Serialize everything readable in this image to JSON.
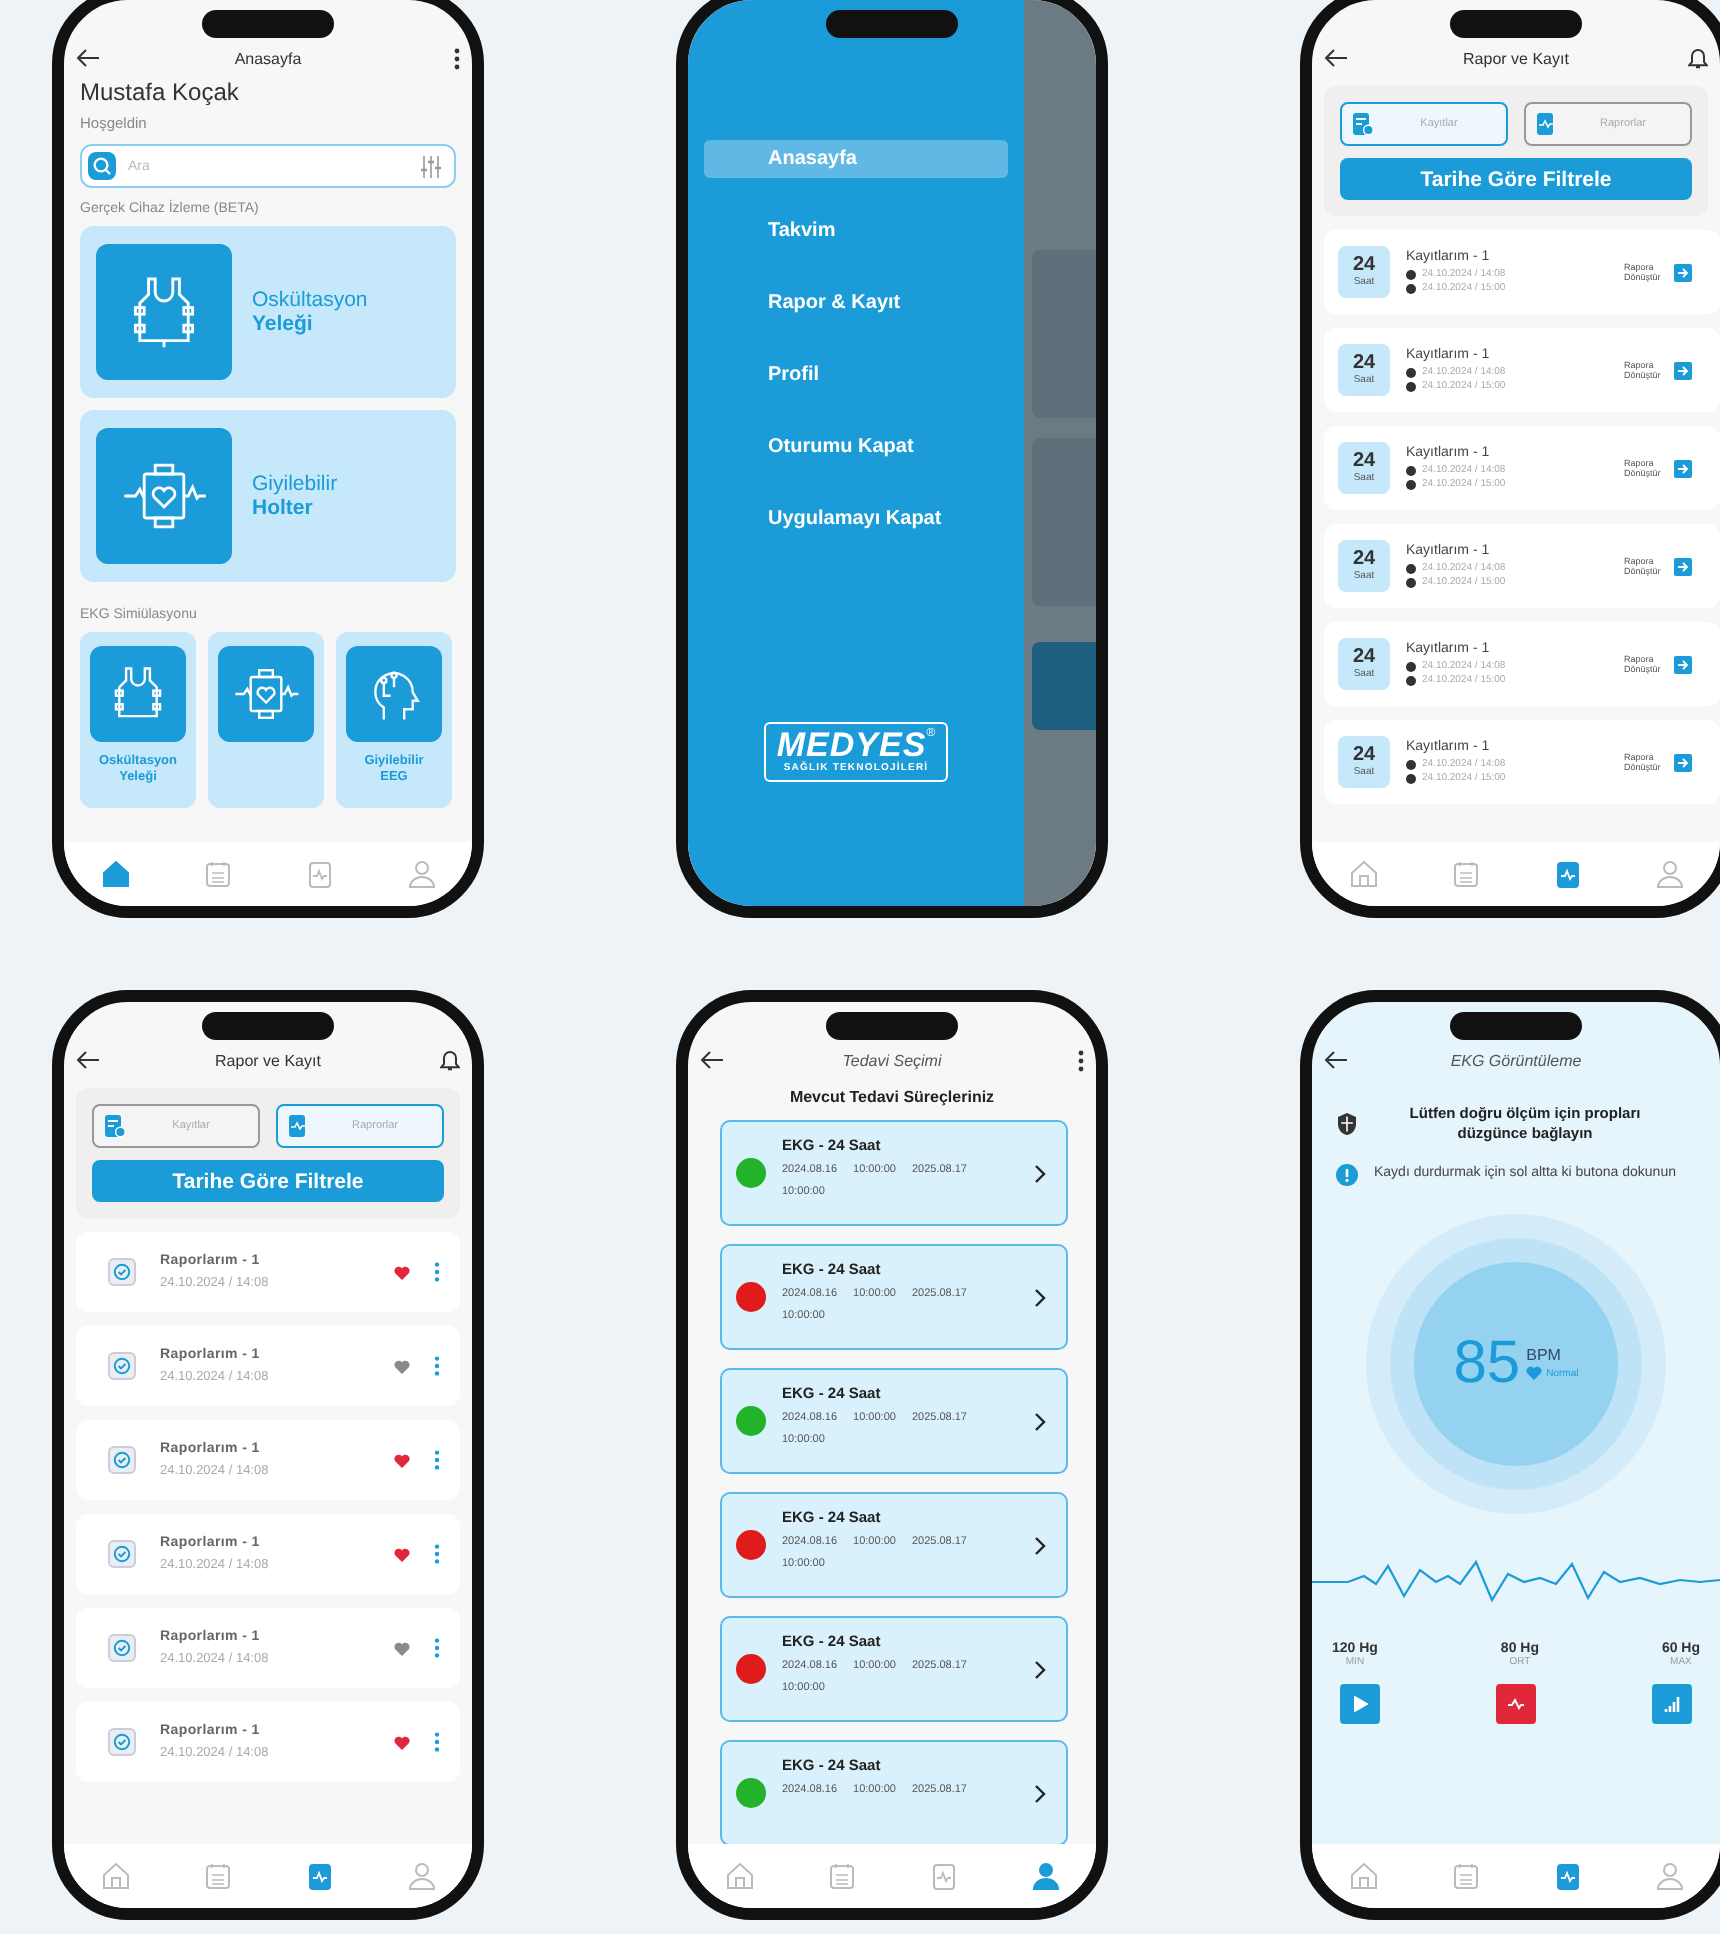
{
  "phones": [
    {
      "kind": "home",
      "title": "Anasayfa",
      "user_name": "Mustafa Koçak",
      "greeting": "Hoşgeldin",
      "search": {
        "placeholder": "Ara"
      },
      "section_1": "Gerçek Cihaz İzleme (BETA)",
      "device_cards": [
        {
          "kind": "vest",
          "line_1": "Oskültasyon",
          "line_2": "Yeleği"
        },
        {
          "kind": "holter",
          "line_1": "Giyilebilir",
          "line_2": "Holter"
        }
      ],
      "section_2": "EKG Simiülasyonu",
      "sim_cards": [
        {
          "kind": "vest",
          "line_1": "Oskültasyon",
          "line_2": "Yeleği"
        },
        {
          "kind": "holter"
        },
        {
          "kind": "eeg",
          "line_1": "Giyilebilir",
          "line_2": "EEG"
        }
      ],
      "nav": [
        {
          "selected": true
        },
        {
          "selected": false
        },
        {
          "selected": false
        },
        {
          "selected": false
        }
      ]
    },
    {
      "kind": "drawer",
      "menu": [
        {
          "label": "Anasayfa",
          "selected": true
        },
        {
          "label": "Takvim",
          "selected": false
        },
        {
          "label": "Rapor & Kayıt",
          "selected": false
        },
        {
          "label": "Profil",
          "selected": false
        },
        {
          "label": "Oturumu Kapat",
          "selected": false
        },
        {
          "label": "Uygulamayı Kapat",
          "selected": false
        }
      ],
      "logo": {
        "name": "MEDYES",
        "mark": "®",
        "tagline": "SAĞLIK TEKNOLOJİLERİ"
      }
    },
    {
      "kind": "records",
      "title": "Rapor ve Kayıt",
      "tabs": [
        {
          "label": "Kayıtlar",
          "selected": true
        },
        {
          "label": "Raprorlar",
          "selected": false
        }
      ],
      "filter_button": "Tarihe Göre Filtrele",
      "records": [
        {
          "hours": "24",
          "unit": "Saat",
          "title": "Kayıtlarım - 1",
          "start": "24.10.2024 / 14:08",
          "end": "24.10.2024 / 15:00",
          "action": "Rapora Dönüştür"
        },
        {
          "hours": "24",
          "unit": "Saat",
          "title": "Kayıtlarım - 1",
          "start": "24.10.2024 / 14:08",
          "end": "24.10.2024 / 15:00",
          "action": "Rapora Dönüştür"
        },
        {
          "hours": "24",
          "unit": "Saat",
          "title": "Kayıtlarım - 1",
          "start": "24.10.2024 / 14:08",
          "end": "24.10.2024 / 15:00",
          "action": "Rapora Dönüştür"
        },
        {
          "hours": "24",
          "unit": "Saat",
          "title": "Kayıtlarım - 1",
          "start": "24.10.2024 / 14:08",
          "end": "24.10.2024 / 15:00",
          "action": "Rapora Dönüştür"
        },
        {
          "hours": "24",
          "unit": "Saat",
          "title": "Kayıtlarım - 1",
          "start": "24.10.2024 / 14:08",
          "end": "24.10.2024 / 15:00",
          "action": "Rapora Dönüştür"
        },
        {
          "hours": "24",
          "unit": "Saat",
          "title": "Kayıtlarım - 1",
          "start": "24.10.2024 / 14:08",
          "end": "24.10.2024 / 15:00",
          "action": "Rapora Dönüştür"
        }
      ],
      "nav": [
        {
          "selected": false
        },
        {
          "selected": false
        },
        {
          "selected": true
        },
        {
          "selected": false
        }
      ]
    },
    {
      "kind": "reports",
      "title": "Rapor ve Kayıt",
      "tabs": [
        {
          "label": "Kayıtlar",
          "selected": false
        },
        {
          "label": "Raprorlar",
          "selected": true
        }
      ],
      "filter_button": "Tarihe Göre Filtrele",
      "reports": [
        {
          "title": "Raporlarım - 1",
          "date": "24.10.2024 / 14:08",
          "favorite": true
        },
        {
          "title": "Raporlarım - 1",
          "date": "24.10.2024 / 14:08",
          "favorite": false
        },
        {
          "title": "Raporlarım - 1",
          "date": "24.10.2024 / 14:08",
          "favorite": true
        },
        {
          "title": "Raporlarım - 1",
          "date": "24.10.2024 / 14:08",
          "favorite": true
        },
        {
          "title": "Raporlarım - 1",
          "date": "24.10.2024 / 14:08",
          "favorite": false
        },
        {
          "title": "Raporlarım - 1",
          "date": "24.10.2024 / 14:08",
          "favorite": true
        }
      ],
      "nav": [
        {
          "selected": false
        },
        {
          "selected": false
        },
        {
          "selected": true
        },
        {
          "selected": false
        }
      ]
    },
    {
      "kind": "treatments",
      "title": "Tedavi Seçimi",
      "heading": "Mevcut Tedavi Süreçleriniz",
      "treatments": [
        {
          "title": "EKG - 24 Saat",
          "color": "#22b32a",
          "start_date": "2024.08.16",
          "start_time": "10:00:00",
          "end_date": "2025.08.17",
          "end_time": "10:00:00"
        },
        {
          "title": "EKG - 24 Saat",
          "color": "#e01b1b",
          "start_date": "2024.08.16",
          "start_time": "10:00:00",
          "end_date": "2025.08.17",
          "end_time": "10:00:00"
        },
        {
          "title": "EKG - 24 Saat",
          "color": "#22b32a",
          "start_date": "2024.08.16",
          "start_time": "10:00:00",
          "end_date": "2025.08.17",
          "end_time": "10:00:00"
        },
        {
          "title": "EKG - 24 Saat",
          "color": "#e01b1b",
          "start_date": "2024.08.16",
          "start_time": "10:00:00",
          "end_date": "2025.08.17",
          "end_time": "10:00:00"
        },
        {
          "title": "EKG - 24 Saat",
          "color": "#e01b1b",
          "start_date": "2024.08.16",
          "start_time": "10:00:00",
          "end_date": "2025.08.17",
          "end_time": "10:00:00"
        },
        {
          "title": "EKG - 24 Saat",
          "color": "#22b32a",
          "start_date": "2024.08.16",
          "start_time": "10:00:00",
          "end_date": "2025.08.17"
        }
      ],
      "nav": [
        {
          "selected": false
        },
        {
          "selected": false
        },
        {
          "selected": false
        },
        {
          "selected": true
        }
      ]
    },
    {
      "kind": "ekg",
      "title": "EKG Görüntüleme",
      "notices": [
        {
          "kind": "shield",
          "text": "Lütfen doğru ölçüm için propları düzgünce bağlayın"
        },
        {
          "kind": "info",
          "text": "Kaydı durdurmak için sol altta ki butona dokunun"
        }
      ],
      "bpm": "85",
      "unit": "BPM",
      "status": "Normal",
      "stats": [
        {
          "value": "120 Hg",
          "label": "MIN"
        },
        {
          "value": "80 Hg",
          "label": "ORT"
        },
        {
          "value": "60 Hg",
          "label": "MAX"
        }
      ],
      "controls": [
        {
          "kind": "play"
        },
        {
          "kind": "ecg"
        },
        {
          "kind": "bars"
        }
      ],
      "nav": [
        {
          "selected": false
        },
        {
          "selected": false
        },
        {
          "selected": true
        },
        {
          "selected": false
        }
      ]
    }
  ]
}
